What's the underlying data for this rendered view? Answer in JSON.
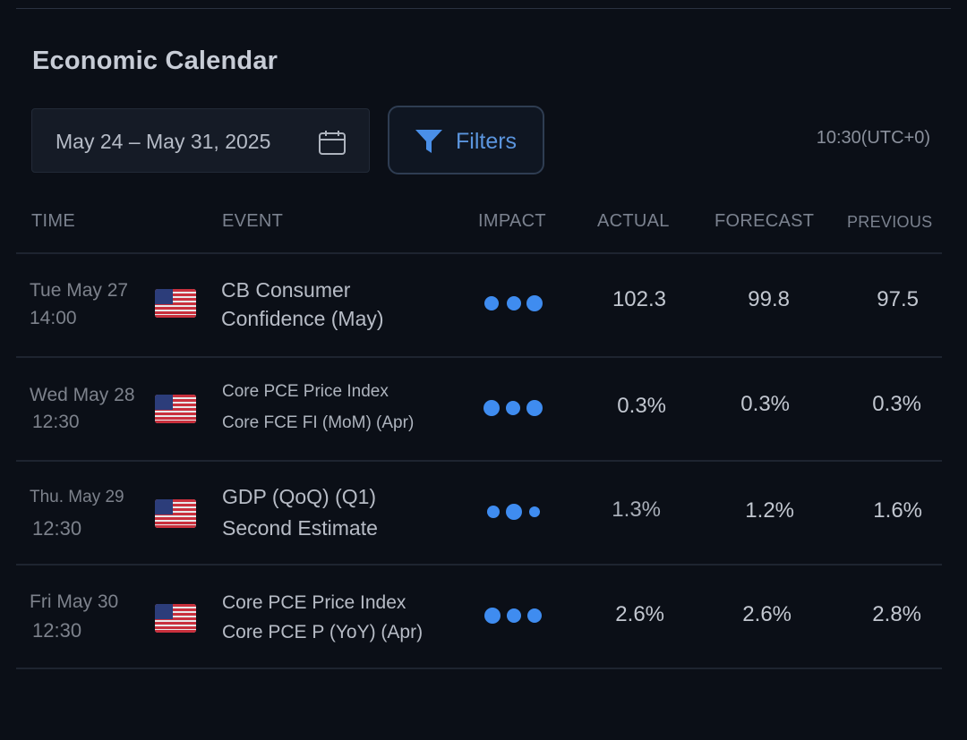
{
  "title": "Economic Calendar",
  "date_range": "May 24 – May 31, 2025",
  "filters_label": "Filters",
  "time_zone": "10:30(UTC+0)",
  "columns": {
    "time": "TIME",
    "event": "EVENT",
    "impact": "IMPACT",
    "actual": "ACTUAL",
    "forecast": "FORECAST",
    "previous": "PREVIOUS"
  },
  "colors": {
    "background": "#0b0f17",
    "accent": "#5b95de",
    "impact_dot": "#3f8cf0"
  },
  "rows": [
    {
      "day": "Tue May 27",
      "time": "14:00",
      "country_flag": "us-flag-icon",
      "event_line1": "CB Consumer",
      "event_line2": "Confidence (May)",
      "impact_level": 3,
      "actual": "102.3",
      "forecast": "99.8",
      "previous": "97.5"
    },
    {
      "day": "Wed May 28",
      "time": "12:30",
      "country_flag": "us-flag-icon",
      "event_line1": "Core PCE Price Index",
      "event_line2": "Core FCE FI (MoM) (Apr)",
      "impact_level": 3,
      "actual": "0.3%",
      "forecast": "0.3%",
      "previous": "0.3%"
    },
    {
      "day": "Thu. May 29",
      "time": "12:30",
      "country_flag": "us-flag-icon",
      "event_line1": "GDP (QoQ) (Q1)",
      "event_line2": "Second Estimate",
      "impact_level": 3,
      "actual": "1.3%",
      "forecast": "1.2%",
      "previous": "1.6%"
    },
    {
      "day": "Fri May 30",
      "time": "12:30",
      "country_flag": "us-flag-icon",
      "event_line1": "Core PCE Price Index",
      "event_line2": "Core PCE P (YoY) (Apr)",
      "impact_level": 3,
      "actual": "2.6%",
      "forecast": "2.6%",
      "previous": "2.8%"
    }
  ]
}
